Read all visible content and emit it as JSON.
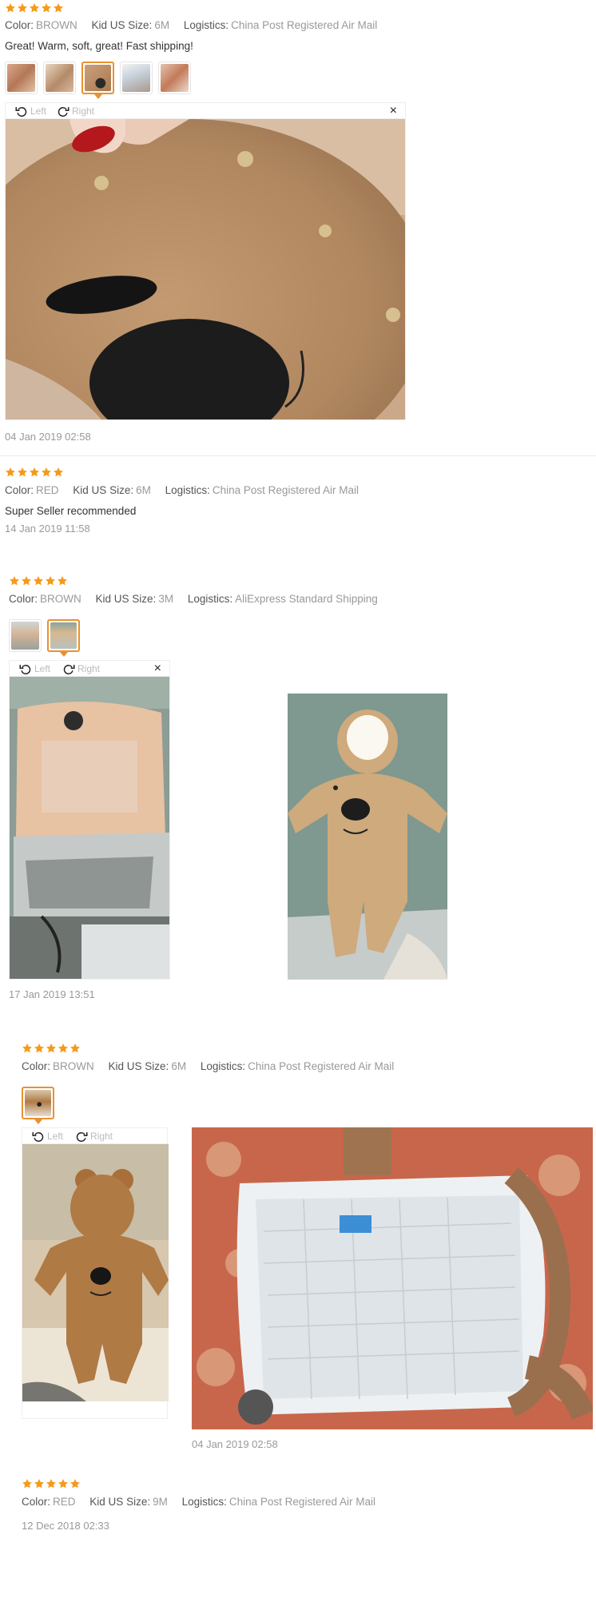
{
  "reviews": [
    {
      "rating": 5,
      "color_label": "Color:",
      "color": "BROWN",
      "size_label": "Kid US Size:",
      "size": "6M",
      "logistics_label": "Logistics:",
      "logistics": "China Post Registered Air Mail",
      "text": "Great! Warm, soft, great! Fast shipping!",
      "viewer": {
        "left": "Left",
        "right": "Right",
        "close": "×"
      },
      "date": "04 Jan 2019 02:58"
    },
    {
      "rating": 5,
      "color_label": "Color:",
      "color": "RED",
      "size_label": "Kid US Size:",
      "size": "6M",
      "logistics_label": "Logistics:",
      "logistics": "China Post Registered Air Mail",
      "text": "Super Seller recommended",
      "date": "14 Jan 2019 11:58"
    },
    {
      "rating": 5,
      "color_label": "Color:",
      "color": "BROWN",
      "size_label": "Kid US Size:",
      "size": "3M",
      "logistics_label": "Logistics:",
      "logistics": "AliExpress Standard Shipping",
      "viewer": {
        "left": "Left",
        "right": "Right",
        "close": "×"
      },
      "date": "17 Jan 2019 13:51"
    },
    {
      "rating": 5,
      "color_label": "Color:",
      "color": "BROWN",
      "size_label": "Kid US Size:",
      "size": "6M",
      "logistics_label": "Logistics:",
      "logistics": "China Post Registered Air Mail",
      "viewer": {
        "left": "Left",
        "right": "Right",
        "close": "×"
      },
      "date": "04 Jan 2019 02:58"
    },
    {
      "rating": 5,
      "color_label": "Color:",
      "color": "RED",
      "size_label": "Kid US Size:",
      "size": "9M",
      "logistics_label": "Logistics:",
      "logistics": "China Post Registered Air Mail",
      "date": "12 Dec 2018 02:33"
    }
  ],
  "icons": {
    "star": "star-icon",
    "rotate_left": "rotate-left-icon",
    "rotate_right": "rotate-right-icon",
    "close": "close-icon"
  },
  "colors": {
    "star": "#f59a1b",
    "accent": "#e8922e",
    "meta": "#999999"
  }
}
